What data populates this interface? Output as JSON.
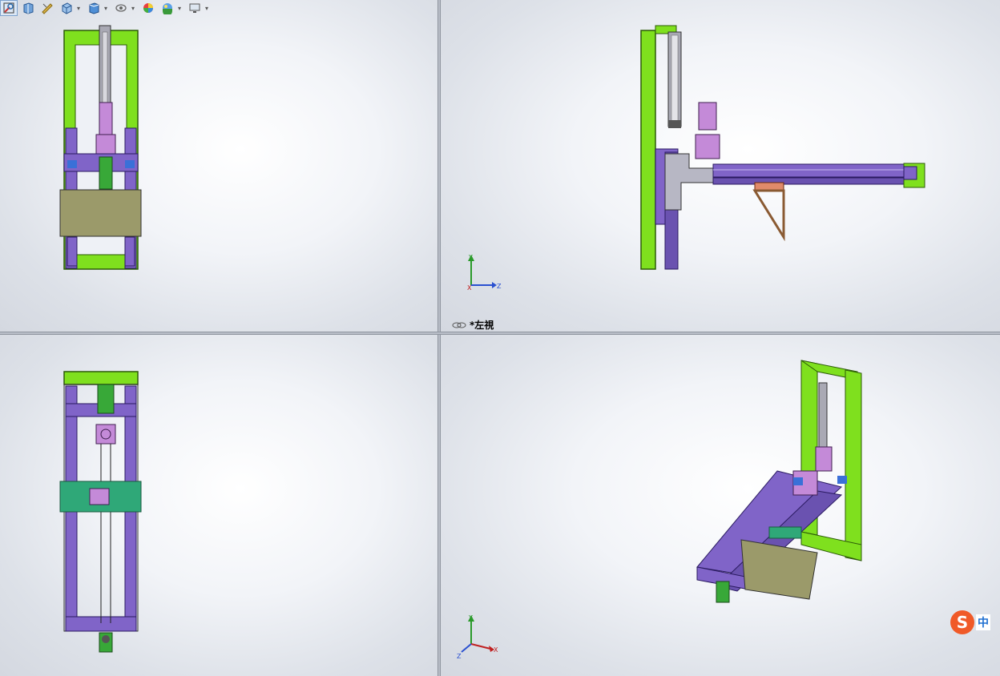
{
  "toolbar": {
    "icons": [
      "zoom-to-fit-icon",
      "section-view-icon",
      "dynamic-annotation-icon",
      "view-orientation-icon",
      "display-style-icon",
      "hide-show-icon",
      "edit-appearance-icon",
      "apply-scene-icon",
      "view-settings-icon"
    ]
  },
  "viewports": {
    "top_right": {
      "label": "*左視"
    }
  },
  "triads": {
    "right_view": {
      "y": "Y",
      "x": "X",
      "z": "Z"
    },
    "iso_view": {
      "y": "Y",
      "x": "X",
      "z": "Z"
    }
  },
  "ime": {
    "logo": "S",
    "mode": "中"
  },
  "colors": {
    "frame_green": "#7fe01e",
    "profile_purple": "#8064c8",
    "part_violet": "#c48ad8",
    "plate_olive": "#9b9a6a",
    "plate_teal": "#2fa878",
    "bracket_brown": "#8a5a32",
    "steel_gray": "#a9a9b4"
  }
}
